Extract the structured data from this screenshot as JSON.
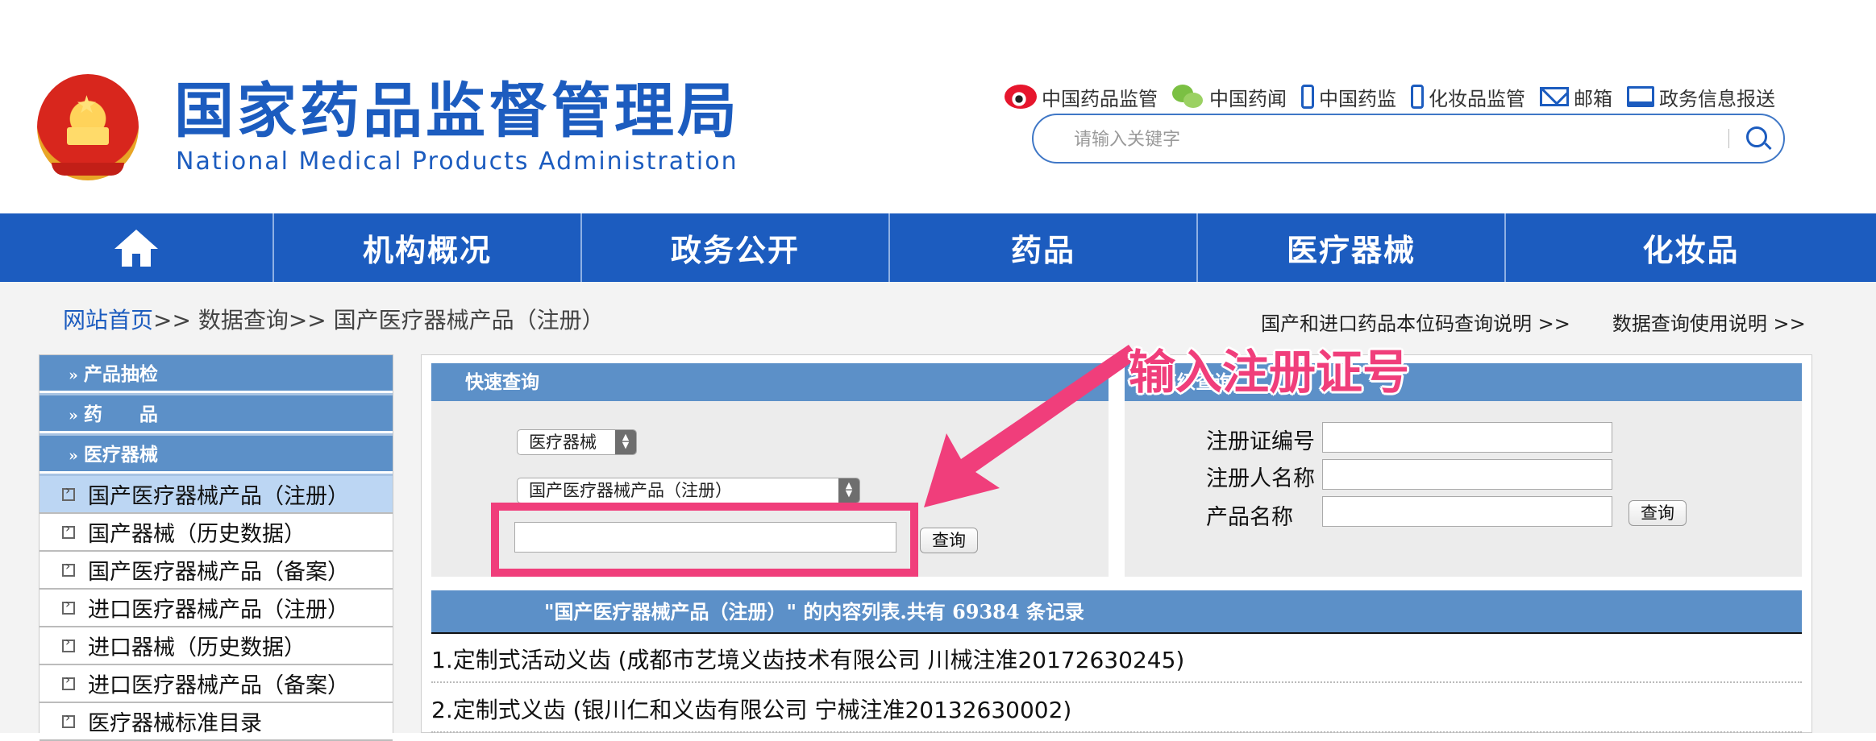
{
  "header": {
    "title_cn": "国家药品监督管理局",
    "title_en": "National Medical Products Administration",
    "quick_links": [
      {
        "label": "中国药品监管",
        "icon": "weibo-icon"
      },
      {
        "label": "中国药闻",
        "icon": "wechat-icon"
      },
      {
        "label": "中国药监",
        "icon": "mobile-icon"
      },
      {
        "label": "化妆品监管",
        "icon": "mobile-icon"
      },
      {
        "label": "邮箱",
        "icon": "mail-icon"
      },
      {
        "label": "政务信息报送",
        "icon": "monitor-icon"
      }
    ],
    "search_placeholder": "请输入关键字"
  },
  "nav": {
    "home_icon": "home-icon",
    "items": [
      "机构概况",
      "政务公开",
      "药品",
      "医疗器械",
      "化妆品"
    ]
  },
  "breadcrumb": {
    "home": "网站首页",
    "rest": ">> 数据查询>> 国产医疗器械产品（注册）"
  },
  "top_links": [
    "国产和进口药品本位码查询说明 >>",
    "数据查询使用说明 >>"
  ],
  "sidebar": {
    "chevron": "»",
    "headers": [
      "产品抽检",
      "药　　品",
      "医疗器械"
    ],
    "items": [
      "国产医疗器械产品（注册）",
      "国产器械（历史数据）",
      "国产医疗器械产品（备案）",
      "进口医疗器械产品（注册）",
      "进口器械（历史数据）",
      "进口医疗器械产品（备案）",
      "医疗器械标准目录"
    ]
  },
  "quick_search": {
    "title": "快速查询",
    "category_value": "医疗器械",
    "database_value": "国产医疗器械产品（注册）",
    "input_value": "",
    "button": "查询"
  },
  "advanced_search": {
    "title": "高级查询",
    "fields": [
      "注册证编号",
      "注册人名称",
      "产品名称"
    ],
    "button": "查询"
  },
  "annotation": {
    "text": "输入注册证号",
    "color": "#f03e7b"
  },
  "results": {
    "header": "\"国产医疗器械产品（注册）\" 的内容列表.共有 69384 条记录",
    "records": [
      "1.定制式活动义齿 (成都市艺境义齿技术有限公司 川械注准20172630245)",
      "2.定制式义齿 (银川仁和义齿有限公司 宁械注准20132630002)"
    ]
  },
  "colors": {
    "brand_blue": "#1c5cbf",
    "panel_blue": "#5c90c8",
    "active_item": "#bcd6f3"
  }
}
